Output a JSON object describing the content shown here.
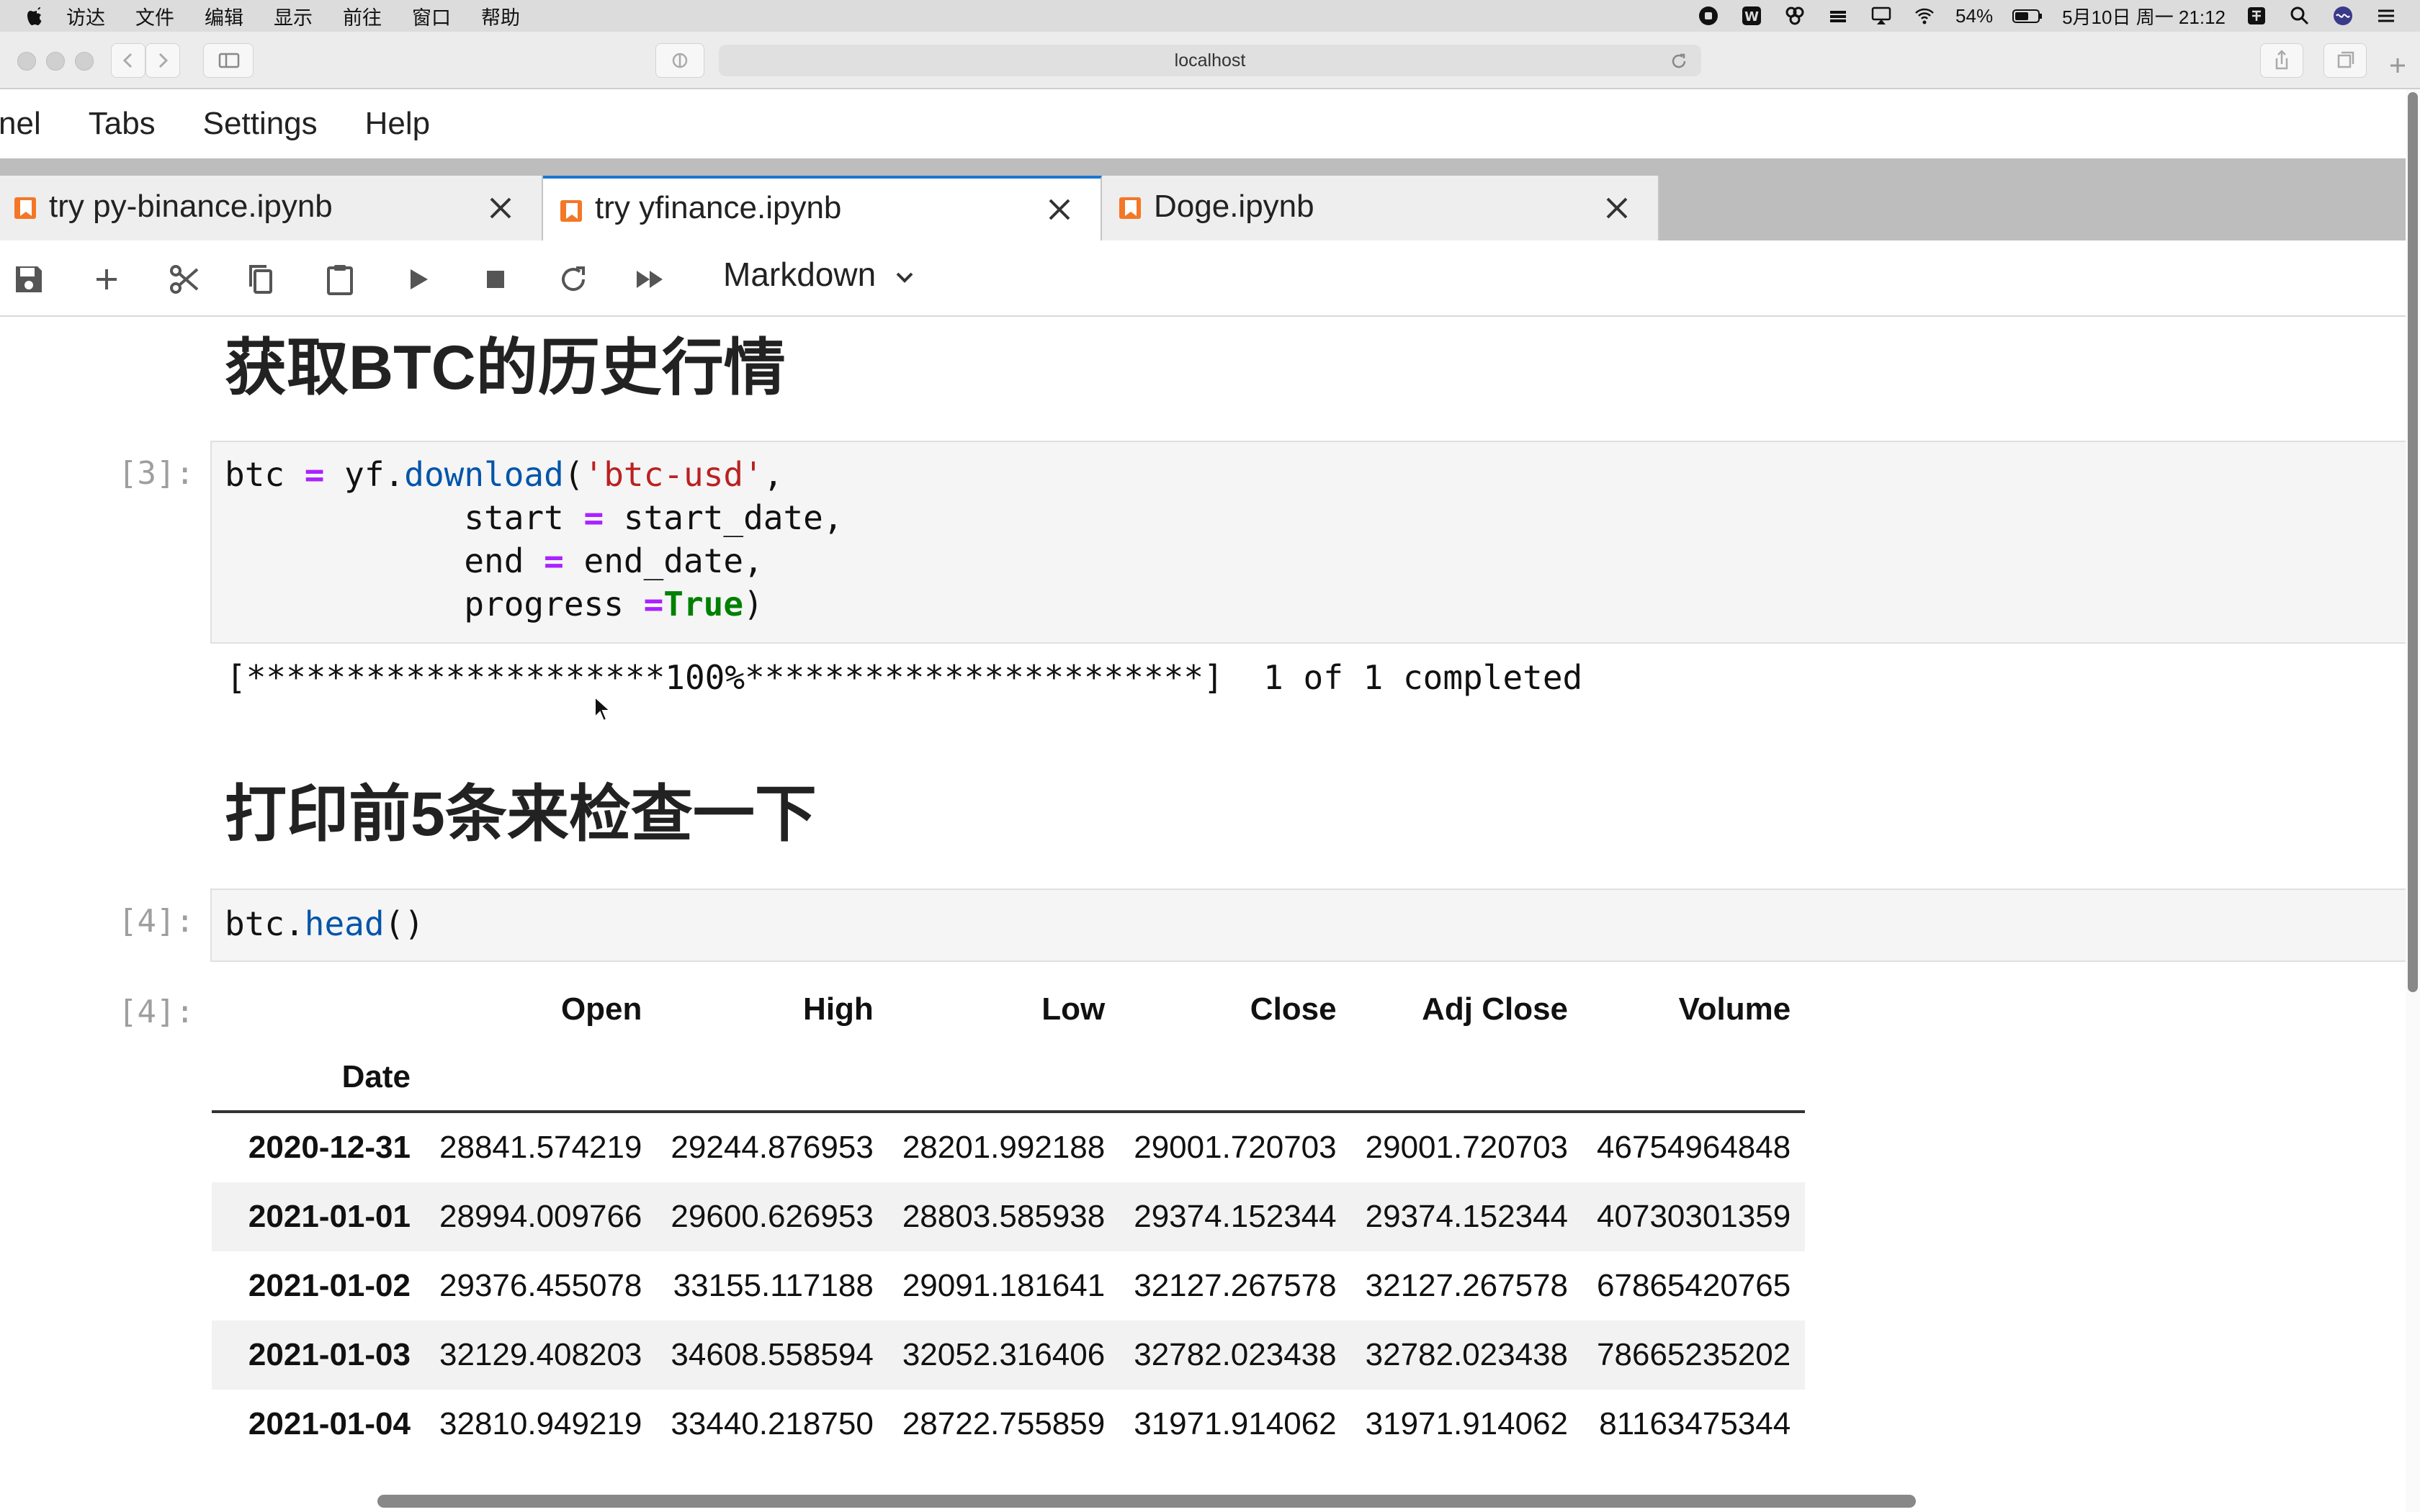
{
  "menubar": {
    "items": [
      "访达",
      "文件",
      "编辑",
      "显示",
      "前往",
      "窗口",
      "帮助"
    ],
    "battery": "54%",
    "clock": "5月10日 周一 21:12"
  },
  "browser": {
    "address": "localhost"
  },
  "jupyter_menu": [
    "nel",
    "Tabs",
    "Settings",
    "Help"
  ],
  "tabs": [
    {
      "label": "try py-binance.ipynb",
      "active": false
    },
    {
      "label": "try yfinance.ipynb",
      "active": true
    },
    {
      "label": "Doge.ipynb",
      "active": false
    }
  ],
  "toolbar": {
    "cell_type": "Markdown"
  },
  "notebook": {
    "heading1": "获取BTC的历史行情",
    "cell3": {
      "prompt": "[3]:",
      "lines": [
        {
          "a": "btc ",
          "op": "=",
          "b": " yf.",
          "fn": "download",
          "c": "(",
          "s": "'btc-usd'",
          "d": ","
        },
        {
          "indent": "            ",
          "a": "start ",
          "op": "=",
          "b": " start_date,"
        },
        {
          "indent": "            ",
          "a": "end ",
          "op": "=",
          "b": " end_date,"
        },
        {
          "indent": "            ",
          "a": "progress ",
          "op": "=",
          "bool": "True",
          "b": ")"
        }
      ]
    },
    "progress_output": "[*********************100%***********************]  1 of 1 completed",
    "heading2": "打印前5条来检查一下",
    "cell4": {
      "prompt": "[4]:",
      "code_obj": "btc.",
      "code_fn": "head",
      "code_tail": "()",
      "out_prompt": "[4]:"
    },
    "table": {
      "columns": [
        "Open",
        "High",
        "Low",
        "Close",
        "Adj Close",
        "Volume"
      ],
      "index_name": "Date",
      "rows": [
        {
          "date": "2020-12-31",
          "values": [
            "28841.574219",
            "29244.876953",
            "28201.992188",
            "29001.720703",
            "29001.720703",
            "46754964848"
          ]
        },
        {
          "date": "2021-01-01",
          "values": [
            "28994.009766",
            "29600.626953",
            "28803.585938",
            "29374.152344",
            "29374.152344",
            "40730301359"
          ]
        },
        {
          "date": "2021-01-02",
          "values": [
            "29376.455078",
            "33155.117188",
            "29091.181641",
            "32127.267578",
            "32127.267578",
            "67865420765"
          ]
        },
        {
          "date": "2021-01-03",
          "values": [
            "32129.408203",
            "34608.558594",
            "32052.316406",
            "32782.023438",
            "32782.023438",
            "78665235202"
          ]
        },
        {
          "date": "2021-01-04",
          "values": [
            "32810.949219",
            "33440.218750",
            "28722.755859",
            "31971.914062",
            "31971.914062",
            "81163475344"
          ]
        }
      ]
    }
  },
  "colors": {
    "accent": "#1976d2",
    "notebook_icon": "#f37726",
    "operator": "#aa22ff",
    "function": "#0055aa",
    "string": "#ba2121",
    "boolean": "#008000"
  }
}
